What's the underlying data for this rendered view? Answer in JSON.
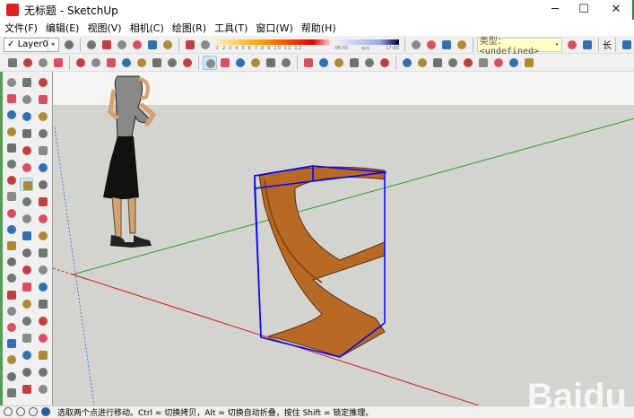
{
  "window": {
    "title": "无标题 - SketchUp",
    "minimize": "─",
    "maximize": "☐",
    "close": "✕"
  },
  "menu": [
    "文件(F)",
    "编辑(E)",
    "视图(V)",
    "相机(C)",
    "绘图(R)",
    "工具(T)",
    "窗口(W)",
    "帮助(H)"
  ],
  "toolbar1": {
    "layer_check": "✓",
    "layer": "Layer0",
    "icons_a": [
      "layer-manager-icon"
    ],
    "icons_b": [
      "iso-view-icon",
      "top-view-icon",
      "front-view-icon",
      "right-view-icon",
      "back-view-icon",
      "left-view-icon"
    ],
    "icons_c": [
      "shadow-settings-icon",
      "fog-icon"
    ],
    "shadow_months": "1 2 3 4 5 6 7 8 9 10 11 12",
    "time_start": "06:55",
    "time_mid": "中午",
    "time_end": "17:00",
    "icons_d": [
      "location-icon",
      "sandbox-icon",
      "geo-icon",
      "3d-warehouse-icon"
    ],
    "type_label": "类型：<undefined>",
    "icons_e": [
      "dynamic-component-icon",
      "component-attributes-icon"
    ],
    "length_label": "长",
    "icons_f": [
      "ruby-console-icon"
    ]
  },
  "toolbar2": {
    "groups": [
      [
        "select-icon",
        "component-icon",
        "paint-bucket-icon",
        "eraser-icon"
      ],
      [
        "rectangle-icon",
        "line-icon",
        "circle-icon",
        "freehand-icon",
        "polygon-icon",
        "arc-icon",
        "pie-icon",
        "two-point-arc-icon"
      ],
      [
        "move-icon",
        "push-pull-icon",
        "rotate-icon",
        "follow-me-icon",
        "scale-icon",
        "offset-icon"
      ],
      [
        "tape-measure-icon",
        "dimension-icon",
        "protractor-icon",
        "text-icon",
        "axes-icon",
        "3d-text-icon"
      ],
      [
        "orbit-icon",
        "pan-icon",
        "zoom-icon",
        "zoom-window-icon",
        "zoom-extents-icon",
        "previous-view-icon",
        "position-camera-icon",
        "look-around-icon",
        "walk-icon"
      ]
    ],
    "active": "move-icon"
  },
  "left_a": [
    "view-iso-icon",
    "view-top-icon",
    "view-front-icon",
    "view-right-icon",
    "view-back-icon",
    "view-left-icon",
    "style-xray-icon",
    "style-wireframe-icon",
    "style-hidden-line-icon",
    "style-shaded-icon",
    "style-textured-icon",
    "style-monochrome-icon",
    "section-plane-icon",
    "sandbox-from-contours-icon",
    "sandbox-smoove-icon",
    "sandbox-stamp-icon",
    "sandbox-drape-icon",
    "sandbox-add-detail-icon",
    "sandbox-flip-edge-icon",
    "ruby-icon"
  ],
  "left_b": [
    "select-icon",
    "make-component-icon",
    "paint-bucket-icon",
    "eraser-icon",
    "rectangle-icon",
    "line-icon",
    "circle-icon",
    "freehand-icon",
    "polygon-icon",
    "arc-icon",
    "pie-icon",
    "two-point-arc-icon",
    "move-icon",
    "push-pull-icon",
    "rotate-icon",
    "follow-me-icon",
    "scale-icon",
    "offset-icon",
    "tape-measure-icon",
    "dimension-icon",
    "protractor-icon",
    "text-icon",
    "axes-icon",
    "3d-text-icon",
    "orbit-icon",
    "pan-icon",
    "zoom-icon",
    "zoom-window-icon",
    "zoom-extents-icon",
    "previous-icon",
    "position-camera-icon",
    "look-around-icon",
    "walk-icon",
    "section-icon",
    "advanced-camera-icon",
    "sandbox-icon",
    "ruby-icon",
    "hand-icon"
  ],
  "status": {
    "text": "选取两个点进行移动。Ctrl = 切换拷贝，Alt = 切换自动折叠，按住 Shift = 锁定推理。",
    "icons": [
      "geo-location-icon",
      "credits-icon",
      "user-icon",
      "help-icon"
    ]
  },
  "watermark": "Baidu 经",
  "colors": {
    "sky": "#f4f4f2",
    "ground": "#d3d3cf",
    "x_axis": "#d02020",
    "y_axis": "#20a020",
    "z_axis": "#2020d0",
    "selection": "#0000ff",
    "wood": "#b86a25"
  }
}
